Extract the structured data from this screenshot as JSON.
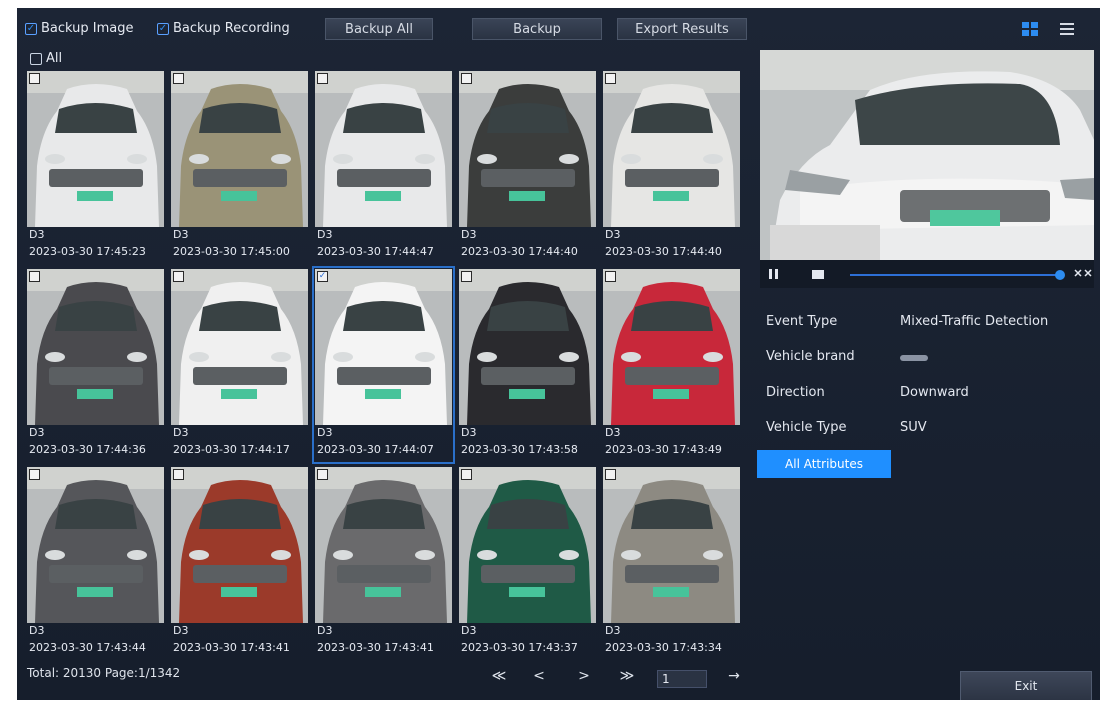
{
  "topbar": {
    "backup_image_label": "Backup Image",
    "backup_recording_label": "Backup Recording",
    "backup_all_label": "Backup All",
    "backup_label": "Backup",
    "export_label": "Export Results",
    "all_label": "All"
  },
  "results": [
    {
      "camera": "D3",
      "time": "2023-03-30 17:45:23",
      "body": "#e8e9ea",
      "checked": false
    },
    {
      "camera": "D3",
      "time": "2023-03-30 17:45:00",
      "body": "#9a9377",
      "checked": false
    },
    {
      "camera": "D3",
      "time": "2023-03-30 17:44:47",
      "body": "#e8e9ea",
      "checked": false
    },
    {
      "camera": "D3",
      "time": "2023-03-30 17:44:40",
      "body": "#3b3d3c",
      "checked": false
    },
    {
      "camera": "D3",
      "time": "2023-03-30 17:44:40",
      "body": "#e6e6e4",
      "checked": false
    },
    {
      "camera": "D3",
      "time": "2023-03-30 17:44:36",
      "body": "#4a4a4e",
      "checked": false
    },
    {
      "camera": "D3",
      "time": "2023-03-30 17:44:17",
      "body": "#f0f0f0",
      "checked": false
    },
    {
      "camera": "D3",
      "time": "2023-03-30 17:44:07",
      "body": "#f4f4f4",
      "checked": true
    },
    {
      "camera": "D3",
      "time": "2023-03-30 17:43:58",
      "body": "#2a2a2e",
      "checked": false
    },
    {
      "camera": "D3",
      "time": "2023-03-30 17:43:49",
      "body": "#c8283a",
      "checked": false
    },
    {
      "camera": "D3",
      "time": "2023-03-30 17:43:44",
      "body": "#55565a",
      "checked": false
    },
    {
      "camera": "D3",
      "time": "2023-03-30 17:43:41",
      "body": "#9b3a2a",
      "checked": false
    },
    {
      "camera": "D3",
      "time": "2023-03-30 17:43:41",
      "body": "#6a6a6c",
      "checked": false
    },
    {
      "camera": "D3",
      "time": "2023-03-30 17:43:37",
      "body": "#1f5a46",
      "checked": false
    },
    {
      "camera": "D3",
      "time": "2023-03-30 17:43:34",
      "body": "#8d8a82",
      "checked": false
    }
  ],
  "footer": {
    "total_text": "Total: 20130  Page:1/1342",
    "first_glyph": "≪",
    "prev_glyph": "<",
    "next_glyph": ">",
    "last_glyph": "≫",
    "page_value": "1",
    "go_glyph": "→"
  },
  "details": {
    "event_type_label": "Event Type",
    "event_type_value": "Mixed-Traffic Detection",
    "vehicle_brand_label": "Vehicle brand",
    "direction_label": "Direction",
    "direction_value": "Downward",
    "vehicle_type_label": "Vehicle Type",
    "vehicle_type_value": "SUV",
    "all_attributes_label": "All Attributes"
  },
  "playback": {
    "progress": 1.0
  },
  "exit_label": "Exit",
  "colors": {
    "accent": "#1f8fff",
    "panel": "#1a2232"
  },
  "icons": [
    "pause-icon",
    "stop-icon",
    "fullscreen-icon",
    "grid-view-icon",
    "list-view-icon",
    "first-page-icon",
    "prev-page-icon",
    "next-page-icon",
    "last-page-icon",
    "go-icon"
  ]
}
